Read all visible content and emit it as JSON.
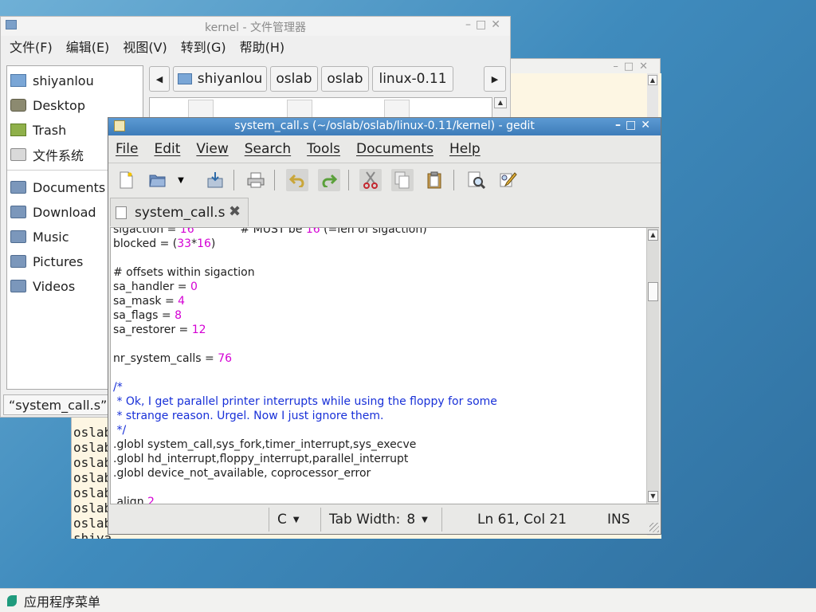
{
  "terminal": {
    "lines": [
      "oslab",
      "oslab",
      "oslab",
      "oslab",
      "oslab",
      "oslab",
      "oslab",
      "shiya"
    ]
  },
  "file_manager": {
    "title": "kernel - 文件管理器",
    "menu": [
      "文件(F)",
      "编辑(E)",
      "视图(V)",
      "转到(G)",
      "帮助(H)"
    ],
    "places": [
      {
        "label": "shiyanlou",
        "icon": "home-folder-icon"
      },
      {
        "label": "Desktop",
        "icon": "desktop-icon"
      },
      {
        "label": "Trash",
        "icon": "trash-icon"
      },
      {
        "label": "文件系统",
        "icon": "filesystem-icon"
      }
    ],
    "bookmarks": [
      {
        "label": "Documents",
        "icon": "folder-icon"
      },
      {
        "label": "Download",
        "icon": "folder-icon"
      },
      {
        "label": "Music",
        "icon": "folder-icon"
      },
      {
        "label": "Pictures",
        "icon": "folder-icon"
      },
      {
        "label": "Videos",
        "icon": "folder-icon"
      }
    ],
    "path": [
      "shiyanlou",
      "oslab",
      "oslab",
      "linux-0.11"
    ],
    "status": "“system_call.s”"
  },
  "gedit": {
    "title": "system_call.s (~/oslab/oslab/linux-0.11/kernel) - gedit",
    "menu": [
      "File",
      "Edit",
      "View",
      "Search",
      "Tools",
      "Documents",
      "Help"
    ],
    "tab_label": "system_call.s",
    "code": {
      "l1a": "sigaction = ",
      "l1b": "16",
      "l1c": "             # MUST be ",
      "l1d": "16",
      "l1e": " (=len of sigaction)",
      "l2a": "blocked = (",
      "l2b": "33",
      "l2c": "*",
      "l2d": "16",
      "l2e": ")",
      "l3": "# offsets within sigaction",
      "l4a": "sa_handler = ",
      "l4b": "0",
      "l5a": "sa_mask = ",
      "l5b": "4",
      "l6a": "sa_flags = ",
      "l6b": "8",
      "l7a": "sa_restorer = ",
      "l7b": "12",
      "l8a": "nr_system_calls = ",
      "l8b": "76",
      "c1": "/*",
      "c2": " * Ok, I get parallel printer interrupts while using the floppy for some",
      "c3": " * strange reason. Urgel. Now I just ignore them.",
      "c4": " */",
      "g1": ".globl system_call,sys_fork,timer_interrupt,sys_execve",
      "g2": ".globl hd_interrupt,floppy_interrupt,parallel_interrupt",
      "g3": ".globl device_not_available, coprocessor_error",
      "a1": ".align ",
      "a2": "2"
    },
    "status": {
      "language": "C",
      "tab_width_label": "Tab Width:",
      "tab_width": "8",
      "position": "Ln 61, Col 21",
      "mode": "INS"
    }
  },
  "taskbar": {
    "menu_label": "应用程序菜单"
  },
  "colors": {
    "number": "#d400d4",
    "comment": "#1830d8",
    "gedit_title": "#4a8ac6"
  }
}
